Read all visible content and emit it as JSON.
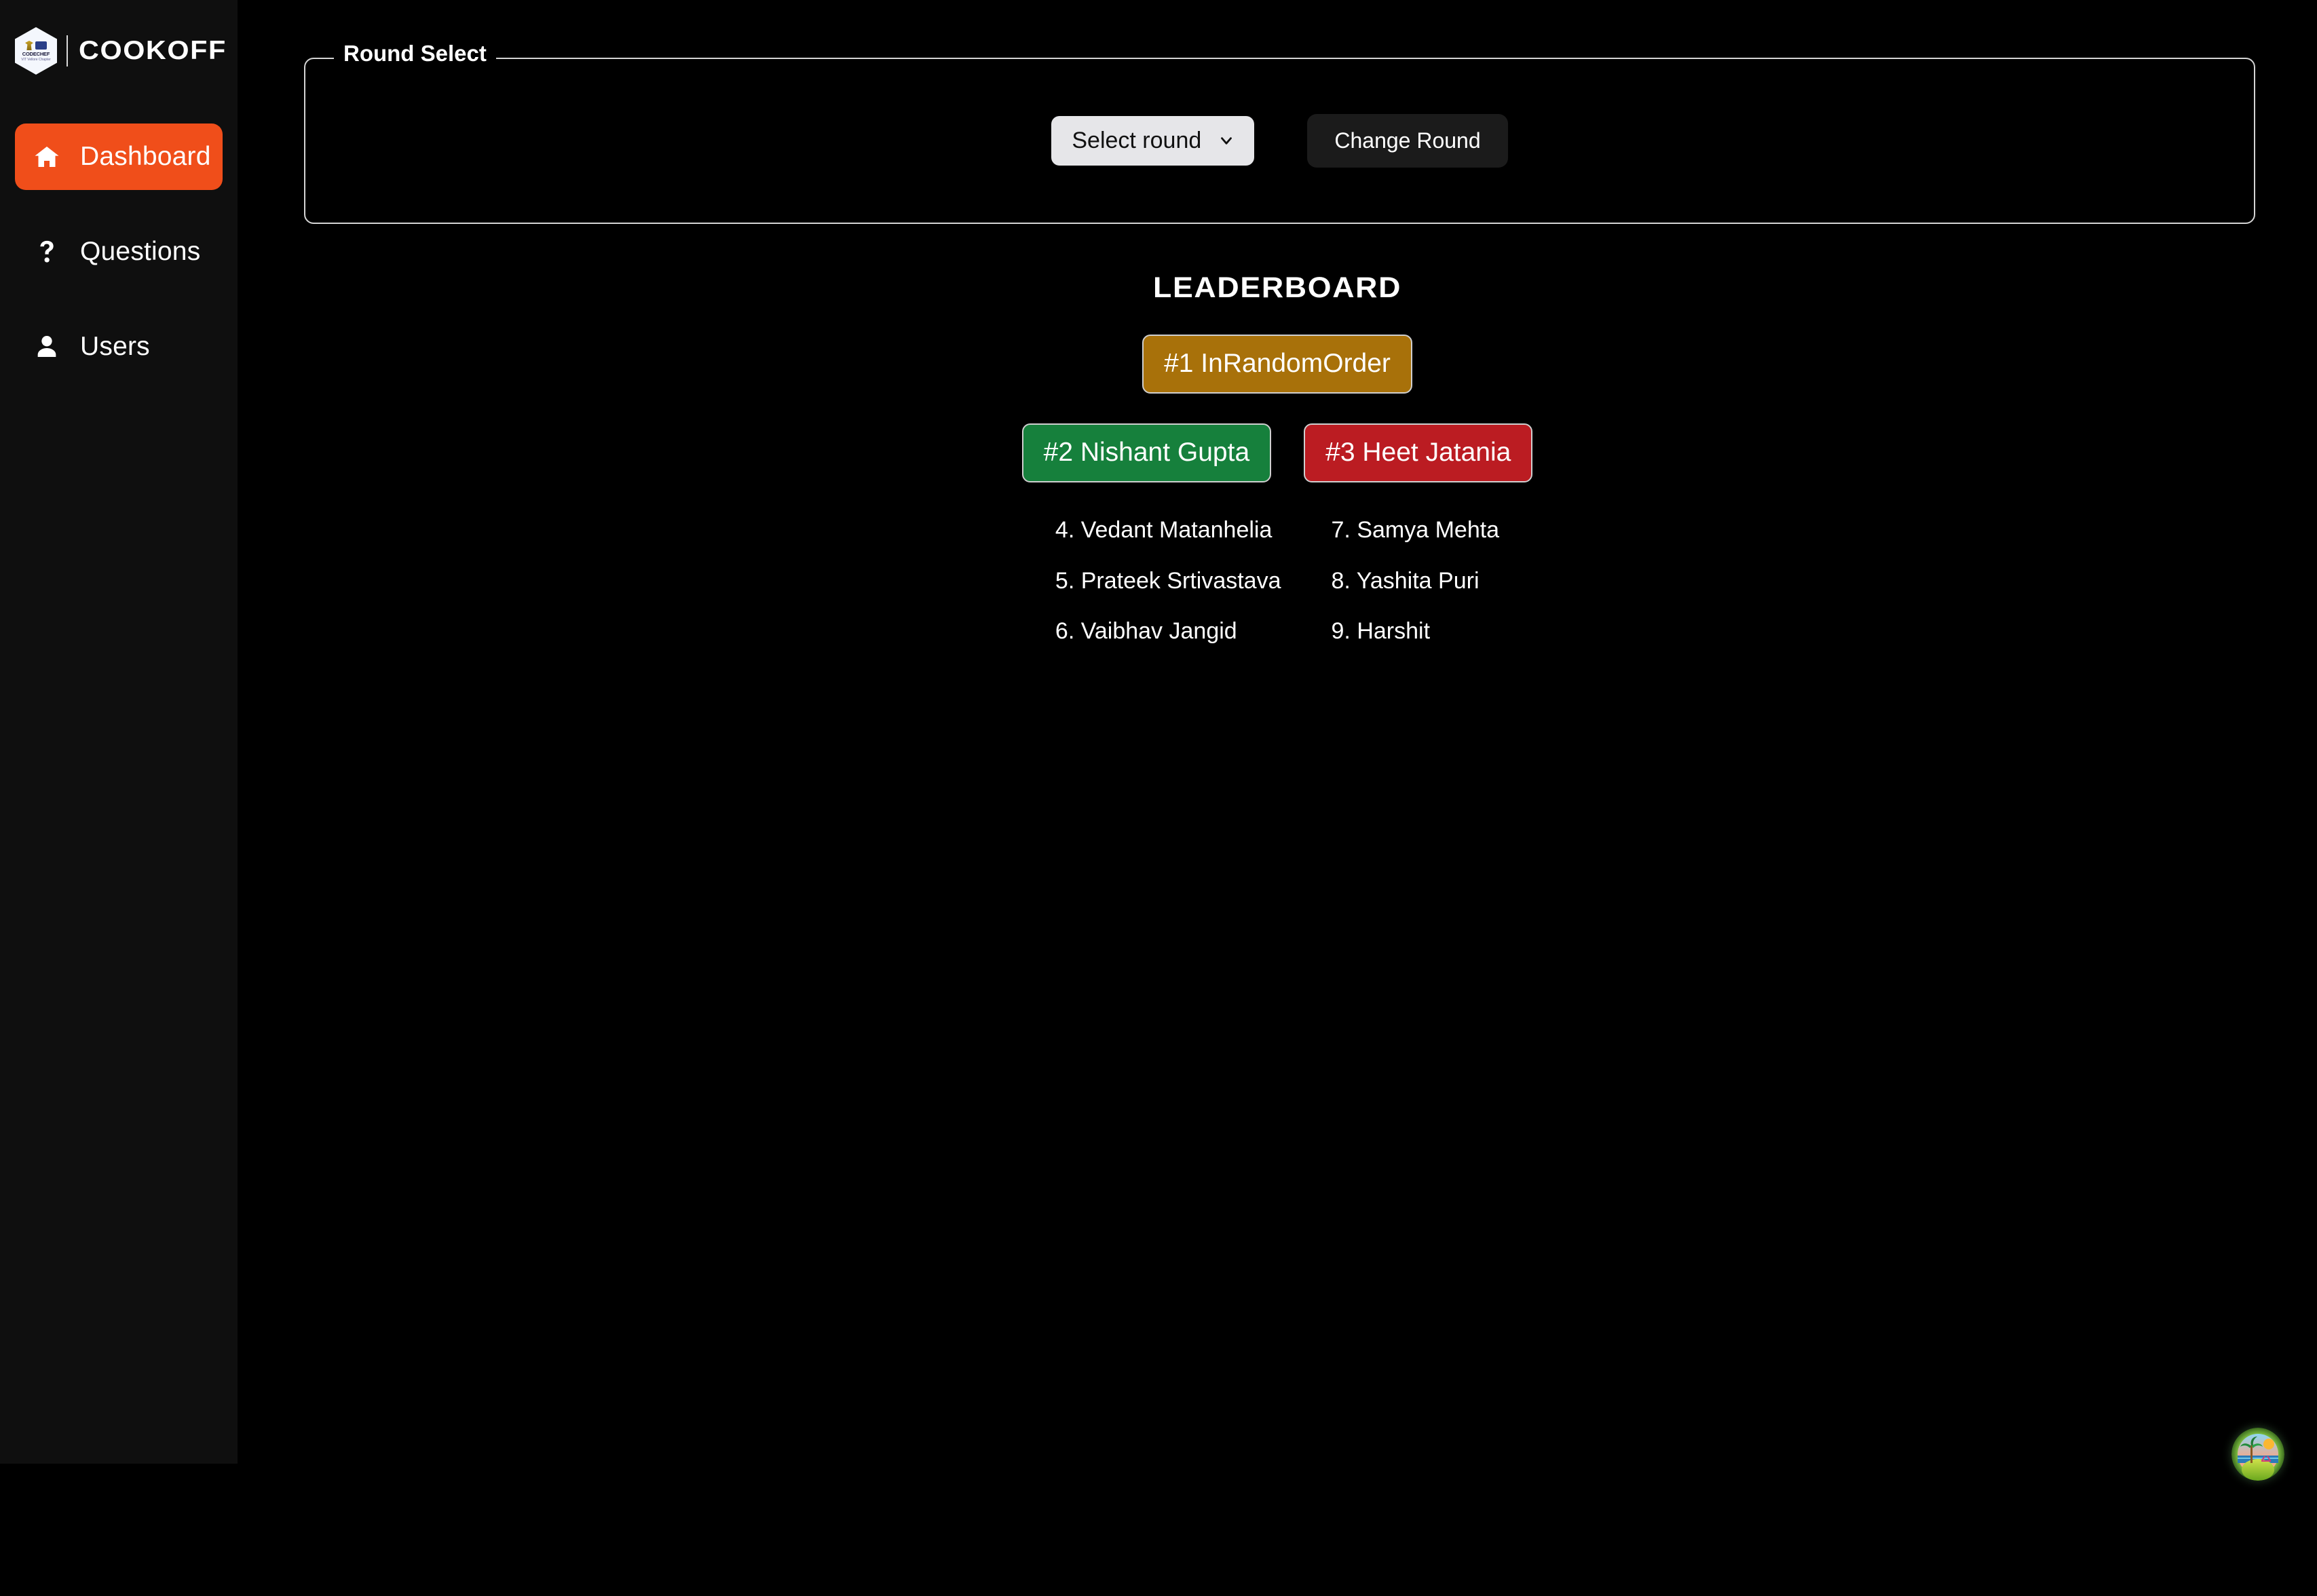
{
  "sidebar": {
    "brand": {
      "badge_title": "CODECHEF",
      "badge_sub": "VIT Vellore Chapter",
      "wordmark": "COOKOFF"
    },
    "items": [
      {
        "label": "Dashboard",
        "icon": "home-icon",
        "active": true
      },
      {
        "label": "Questions",
        "icon": "question-mark-icon",
        "active": false
      },
      {
        "label": "Users",
        "icon": "user-icon",
        "active": false
      }
    ]
  },
  "round_select": {
    "legend": "Round Select",
    "select_value": "Select round",
    "select_options": [
      "Select round"
    ],
    "change_button": "Change Round"
  },
  "leaderboard": {
    "title": "LEADERBOARD",
    "first": "#1 InRandomOrder",
    "second": "#2 Nishant Gupta",
    "third": "#3 Heet Jatania",
    "others_left": [
      "4. Vedant Matanhelia",
      "5. Prateek Srtivastava",
      "6. Vaibhav Jangid"
    ],
    "others_right": [
      "7. Samya Mehta",
      "8. Yashita Puri",
      "9. Harshit"
    ]
  },
  "widget": {
    "icon": "island-beach-icon"
  },
  "colors": {
    "accent_orange": "#f04e1a",
    "gold": "#a8710a",
    "green": "#16803c",
    "red": "#bb1c22",
    "sidebar_bg": "#0f0f0f",
    "page_bg": "#000000"
  }
}
